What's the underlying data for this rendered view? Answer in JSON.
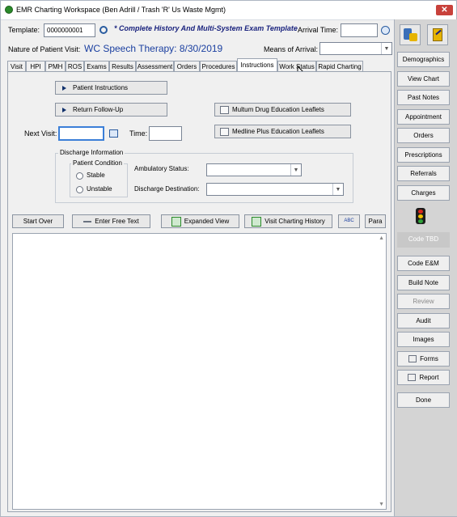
{
  "window": {
    "title": "EMR Charting Workspace (Ben Adrill / Trash 'R' Us Waste Mgmt)",
    "close_label": "✕"
  },
  "header": {
    "template_label": "Template:",
    "template_value": "0000000001",
    "template_name": "* Complete History And Multi-System Exam Template",
    "arrival_time_label": "Arrival Time:",
    "arrival_time_value": "",
    "nature_label": "Nature of Patient Visit:",
    "nature_value": "WC Speech Therapy:  8/30/2019",
    "means_label": "Means of Arrival:",
    "means_value": ""
  },
  "tabs": [
    {
      "label": "Visit"
    },
    {
      "label": "HPI"
    },
    {
      "label": "PMH"
    },
    {
      "label": "ROS"
    },
    {
      "label": "Exams"
    },
    {
      "label": "Results"
    },
    {
      "label": "Assessment"
    },
    {
      "label": "Orders"
    },
    {
      "label": "Procedures"
    },
    {
      "label": "Instructions"
    },
    {
      "label": "Work Status"
    },
    {
      "label": "Rapid Charting"
    }
  ],
  "active_tab": "Instructions",
  "instructions": {
    "patient_instructions_label": "Patient Instructions",
    "return_followup_label": "Return Follow-Up",
    "multum_label": "Multum Drug Education Leaflets",
    "medline_label": "Medline Plus Education Leaflets",
    "next_visit_label": "Next Visit:",
    "next_visit_value": "",
    "time_label": "Time:",
    "time_value": "",
    "discharge_info_label": "Discharge Information",
    "patient_condition_label": "Patient Condition",
    "stable_label": "Stable",
    "unstable_label": "Unstable",
    "ambulatory_label": "Ambulatory Status:",
    "ambulatory_value": "",
    "discharge_dest_label": "Discharge Destination:",
    "discharge_dest_value": ""
  },
  "toolbar": {
    "start_over_label": "Start Over",
    "free_text_label": "Enter Free Text",
    "expanded_view_label": "Expanded View",
    "history_label": "Visit Charting History",
    "spell_label": "ABC",
    "para_label": "Para"
  },
  "sidebar": {
    "demographics": "Demographics",
    "view_chart": "View Chart",
    "past_notes": "Past Notes",
    "appointment": "Appointment",
    "orders": "Orders",
    "prescriptions": "Prescriptions",
    "referrals": "Referrals",
    "charges": "Charges",
    "code_tbd": "Code TBD",
    "code_em": "Code E&M",
    "build_note": "Build Note",
    "review": "Review",
    "audit": "Audit",
    "images": "Images",
    "forms": "Forms",
    "report": "Report",
    "done": "Done"
  },
  "colors": {
    "template_name": "#1a237e",
    "nature_value": "#1a3fa0",
    "traffic_red": "#d9261c",
    "traffic_yellow": "#f2c200",
    "traffic_green": "#2fa23a"
  }
}
